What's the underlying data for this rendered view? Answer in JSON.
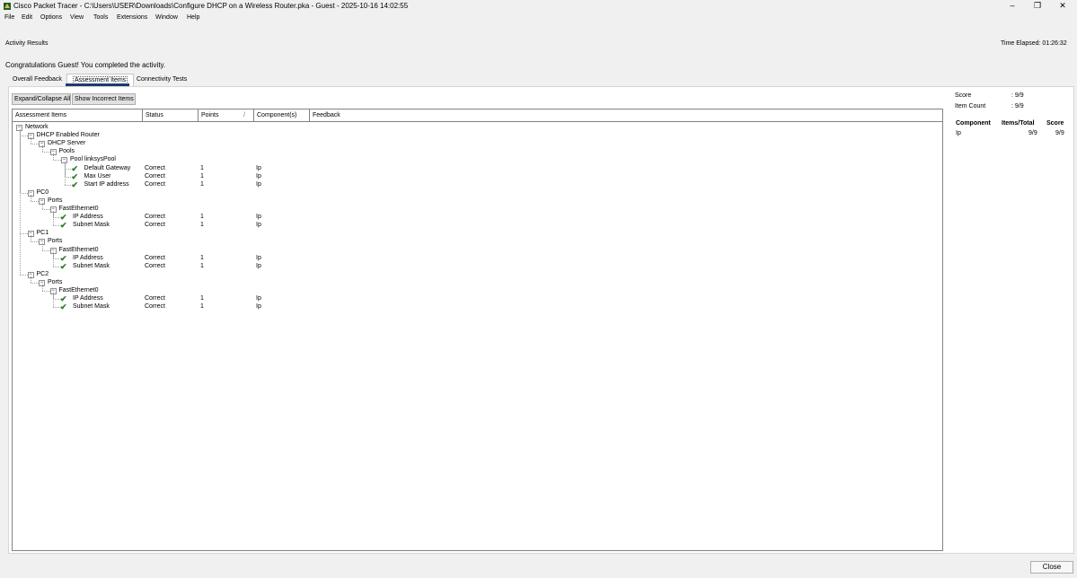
{
  "window": {
    "title": "Cisco Packet Tracer - C:\\Users\\USER\\Downloads\\Configure DHCP on a Wireless Router.pka - Guest - 2025-10-16 14:02:55",
    "minimize": "–",
    "maximize": "❐",
    "close": "✕"
  },
  "menu": [
    "File",
    "Edit",
    "Options",
    "View",
    "Tools",
    "Extensions",
    "Window",
    "Help"
  ],
  "header": {
    "section_title": "Activity Results",
    "time_elapsed": "Time Elapsed: 01:26:32",
    "congrats": "Congratulations Guest! You completed the activity."
  },
  "tabs": [
    {
      "label": "Overall Feedback",
      "active": false
    },
    {
      "label": "Assessment Items",
      "active": true
    },
    {
      "label": "Connectivity Tests",
      "active": false
    }
  ],
  "toolbar": {
    "expand_collapse": "Expand/Collapse All",
    "show_incorrect": "Show Incorrect Items"
  },
  "grid": {
    "columns": [
      "Assessment Items",
      "Status",
      "Points",
      "Component(s)",
      "Feedback"
    ],
    "sort_indicator": "/",
    "rows": [
      {
        "label": "Network",
        "depth": 0,
        "expander": "−"
      },
      {
        "label": "DHCP Enabled Router",
        "depth": 1,
        "expander": "−"
      },
      {
        "label": "DHCP Server",
        "depth": 2,
        "expander": "−"
      },
      {
        "label": "Pools",
        "depth": 3,
        "expander": "−"
      },
      {
        "label": "Pool linksysPool",
        "depth": 4,
        "expander": "−"
      },
      {
        "label": "Default Gateway",
        "depth": 5,
        "check": true,
        "status": "Correct",
        "points": "1",
        "component": "Ip"
      },
      {
        "label": "Max User",
        "depth": 5,
        "check": true,
        "status": "Correct",
        "points": "1",
        "component": "Ip"
      },
      {
        "label": "Start IP address",
        "depth": 5,
        "check": true,
        "status": "Correct",
        "points": "1",
        "component": "Ip"
      },
      {
        "label": "PC0",
        "depth": 1,
        "expander": "−"
      },
      {
        "label": "Ports",
        "depth": 2,
        "expander": "−"
      },
      {
        "label": "FastEthernet0",
        "depth": 3,
        "expander": "−"
      },
      {
        "label": "IP Address",
        "depth": 4,
        "check": true,
        "status": "Correct",
        "points": "1",
        "component": "Ip"
      },
      {
        "label": "Subnet Mask",
        "depth": 4,
        "check": true,
        "status": "Correct",
        "points": "1",
        "component": "Ip"
      },
      {
        "label": "PC1",
        "depth": 1,
        "expander": "−"
      },
      {
        "label": "Ports",
        "depth": 2,
        "expander": "−"
      },
      {
        "label": "FastEthernet0",
        "depth": 3,
        "expander": "−"
      },
      {
        "label": "IP Address",
        "depth": 4,
        "check": true,
        "status": "Correct",
        "points": "1",
        "component": "Ip"
      },
      {
        "label": "Subnet Mask",
        "depth": 4,
        "check": true,
        "status": "Correct",
        "points": "1",
        "component": "Ip"
      },
      {
        "label": "PC2",
        "depth": 1,
        "expander": "−"
      },
      {
        "label": "Ports",
        "depth": 2,
        "expander": "−"
      },
      {
        "label": "FastEthernet0",
        "depth": 3,
        "expander": "−"
      },
      {
        "label": "IP Address",
        "depth": 4,
        "check": true,
        "status": "Correct",
        "points": "1",
        "component": "Ip"
      },
      {
        "label": "Subnet Mask",
        "depth": 4,
        "check": true,
        "status": "Correct",
        "points": "1",
        "component": "Ip"
      }
    ]
  },
  "summary": {
    "score_label": "Score",
    "score_value": ": 9/9",
    "item_count_label": "Item Count",
    "item_count_value": ": 9/9",
    "table_headers": [
      "Component",
      "Items/Total",
      "Score"
    ],
    "table_rows": [
      {
        "component": "Ip",
        "items_total": "9/9",
        "score": "9/9"
      }
    ]
  },
  "footer": {
    "close_label": "Close"
  },
  "colors": {
    "tab_accent": "#1c3b70",
    "check": "#2a7d2a"
  }
}
